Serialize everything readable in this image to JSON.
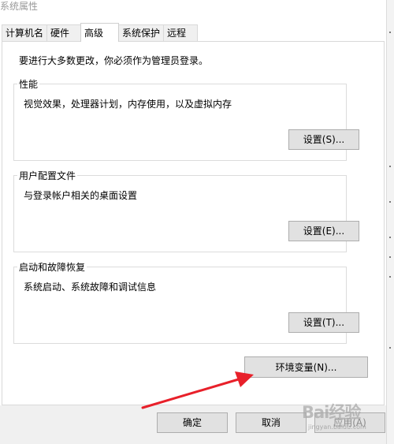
{
  "window": {
    "title": "系统属性"
  },
  "tabs": [
    {
      "label": "计算机名",
      "active": false
    },
    {
      "label": "硬件",
      "active": false
    },
    {
      "label": "高级",
      "active": true
    },
    {
      "label": "系统保护",
      "active": false
    },
    {
      "label": "远程",
      "active": false
    }
  ],
  "admin_note": "要进行大多数更改，你必须作为管理员登录。",
  "groups": {
    "performance": {
      "title": "性能",
      "description": "视觉效果，处理器计划，内存使用，以及虚拟内存",
      "button": "设置(S)..."
    },
    "user_profiles": {
      "title": "用户配置文件",
      "description": "与登录帐户相关的桌面设置",
      "button": "设置(E)..."
    },
    "startup_recovery": {
      "title": "启动和故障恢复",
      "description": "系统启动、系统故障和调试信息",
      "button": "设置(T)..."
    }
  },
  "env_button": "环境变量(N)...",
  "dialog_buttons": {
    "ok": "确定",
    "cancel": "取消",
    "apply": "应用(A)"
  },
  "watermark": {
    "logo": "Bai经验",
    "sub": "jingyan.baidu.com"
  },
  "colors": {
    "annotation_arrow": "#e8202a",
    "button_face": "#e1e1e1",
    "dialog_footer": "#f0f0f0"
  }
}
